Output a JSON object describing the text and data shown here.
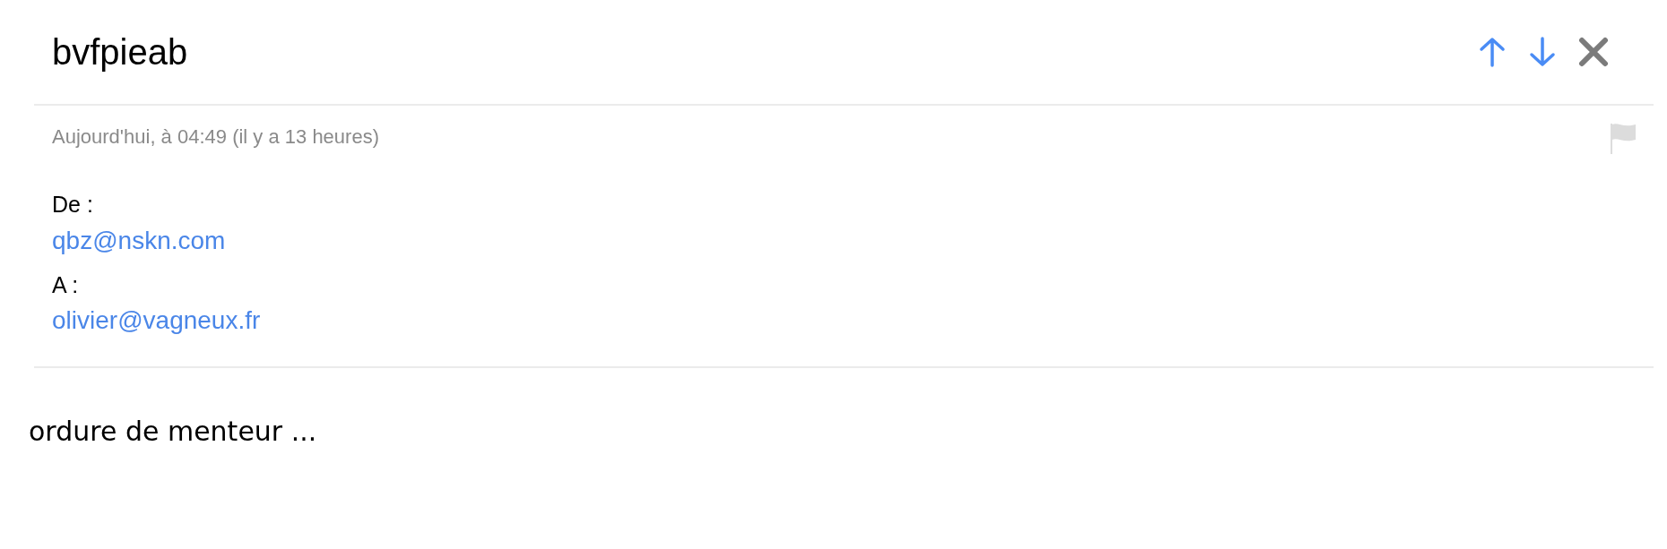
{
  "message": {
    "subject": "bvfpieab",
    "date": "Aujourd'hui, à 04:49 (il y a 13 heures)",
    "flagged": false,
    "from": {
      "label": "De :",
      "address": "qbz@nskn.com"
    },
    "to": {
      "label": "A :",
      "address": "olivier@vagneux.fr"
    },
    "body": "ordure de menteur ..."
  }
}
